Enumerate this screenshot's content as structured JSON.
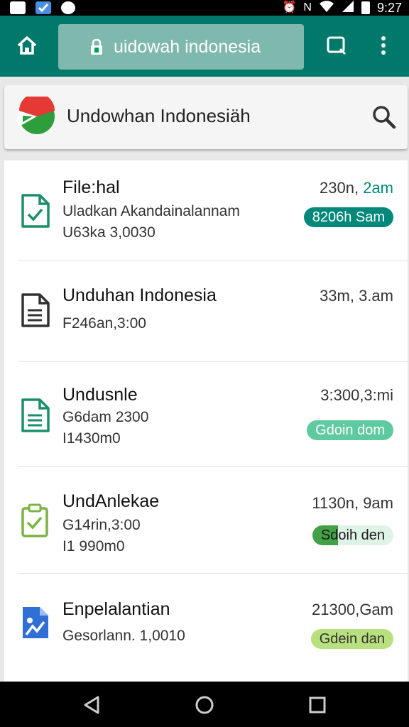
{
  "status_bar": {
    "time": "9:27",
    "icons": [
      "notification-icon",
      "checkbox-app-icon",
      "chat-icon",
      "alarm-icon",
      "nfc-icon",
      "wifi-icon",
      "signal-icon",
      "battery-icon"
    ]
  },
  "toolbar": {
    "url": "uidowah indonesia",
    "color": "#00796b"
  },
  "search_card": {
    "title": "Undowhan Indonesiäh"
  },
  "items": [
    {
      "title": "File:hal",
      "line1": "Uladkan Akandainalannam",
      "line2": "U63ka 3,0030",
      "time_main": "230n,",
      "time_accent": "2am",
      "badge": "8206h Sam",
      "icon": "spreadsheet-check-icon"
    },
    {
      "title": "Unduhan Indonesia",
      "line1": "F246an,3:00",
      "time_main": "33m, 3.am",
      "icon": "document-icon"
    },
    {
      "title": "Undusnle",
      "line1": "G6dam 2300",
      "line2": "I1430m0",
      "time_main": "3:300,3:mi",
      "badge": "Gdoin dom",
      "icon": "spreadsheet-icon"
    },
    {
      "title": "UndAnlekae",
      "line1": "G14rin,3:00",
      "line2": "I1 990m0",
      "time_main": "1130n, 9am",
      "badge": "Sdoih den",
      "icon": "clipboard-check-icon"
    },
    {
      "title": "Enpelalantian",
      "line1": "Gesorlann. 1,0010",
      "time_main": "21300,Gam",
      "badge": "Gdein dan",
      "icon": "image-file-icon"
    }
  ]
}
